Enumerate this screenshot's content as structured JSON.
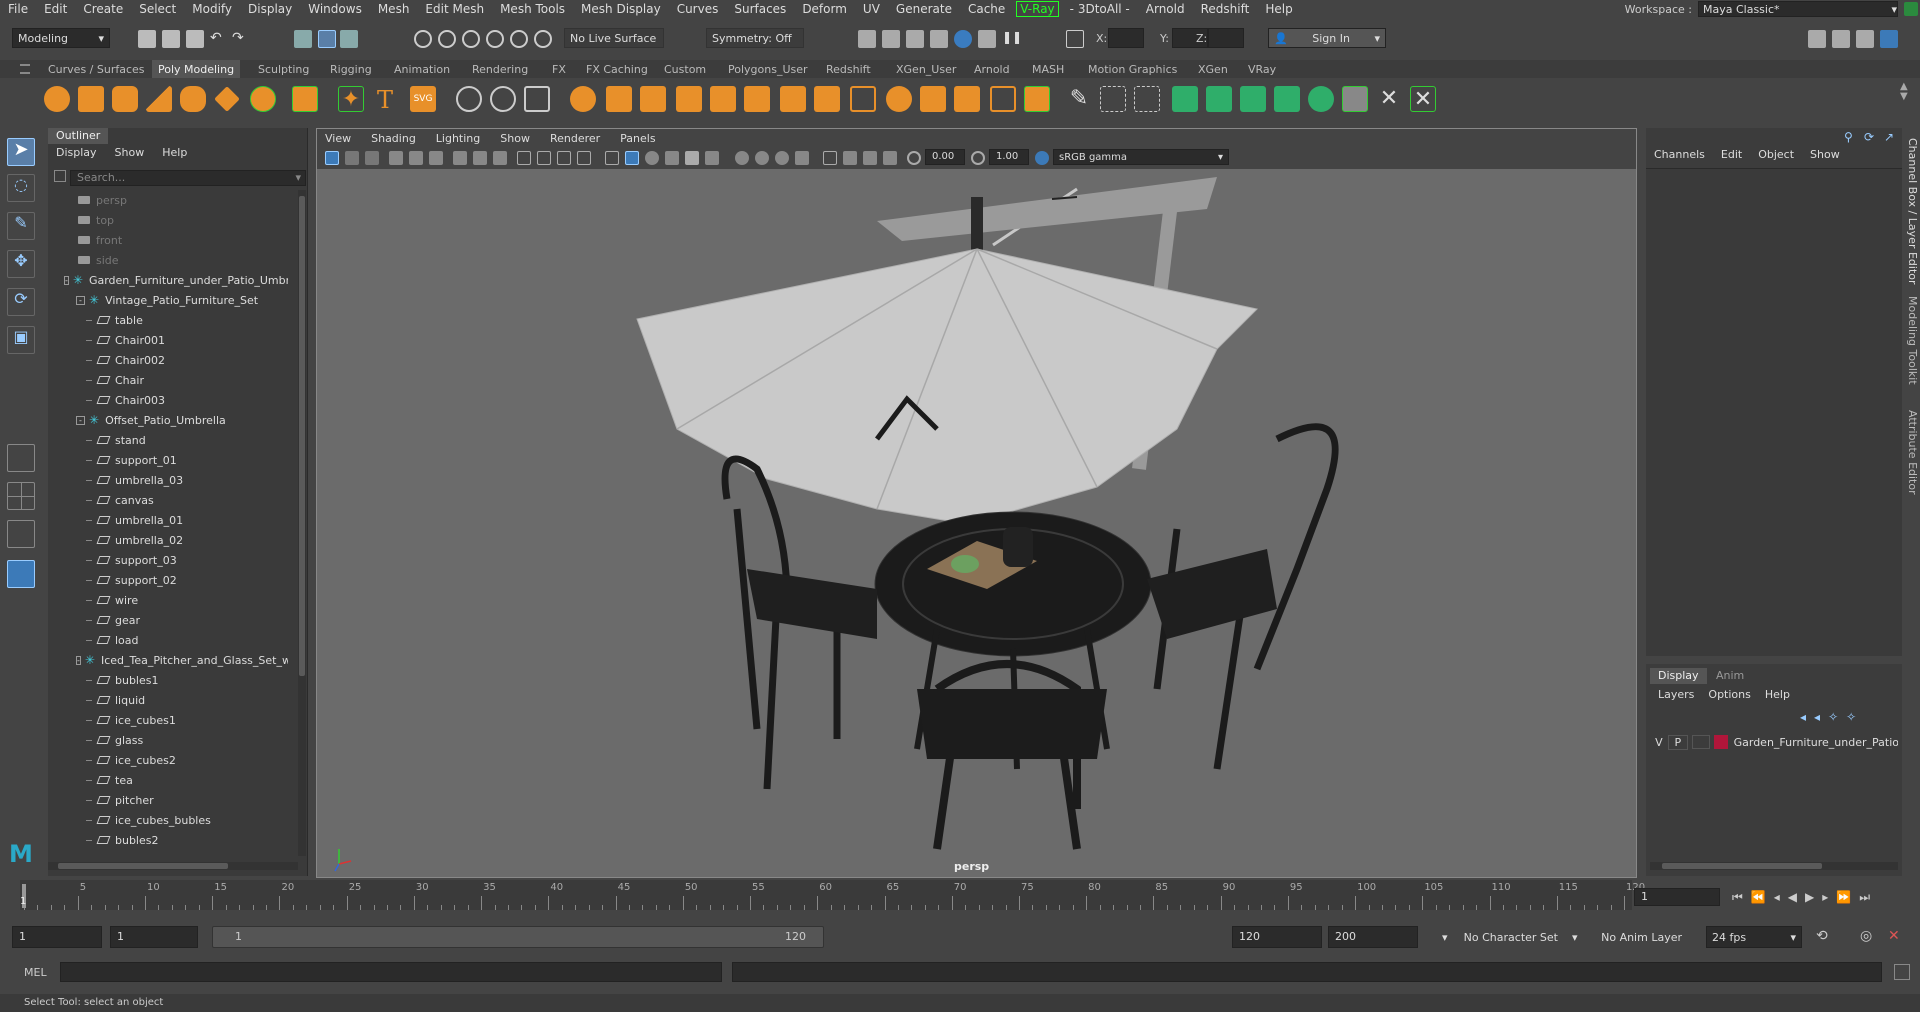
{
  "menubar": {
    "items": [
      "File",
      "Edit",
      "Create",
      "Select",
      "Modify",
      "Display",
      "Windows",
      "Mesh",
      "Edit Mesh",
      "Mesh Tools",
      "Mesh Display",
      "Curves",
      "Surfaces",
      "Deform",
      "UV",
      "Generate",
      "Cache"
    ],
    "vray": "V-Ray",
    "items2": [
      "- 3DtoAll -",
      "Arnold",
      "Redshift",
      "Help"
    ],
    "workspace_label": "Workspace :",
    "workspace_value": "Maya Classic*"
  },
  "statusline": {
    "mode": "Modeling",
    "live_surface": "No Live Surface",
    "symmetry": "Symmetry: Off",
    "x_label": "X:",
    "y_label": "Y:",
    "z_label": "Z:",
    "sign_in": "Sign In"
  },
  "shelf": {
    "tabs": [
      "Curves / Surfaces",
      "Poly Modeling",
      "Sculpting",
      "Rigging",
      "Animation",
      "Rendering",
      "FX",
      "FX Caching",
      "Custom",
      "Polygons_User",
      "Redshift",
      "XGen_User",
      "Arnold",
      "MASH",
      "Motion Graphics",
      "XGen",
      "VRay"
    ],
    "active": "Poly Modeling"
  },
  "outliner": {
    "title": "Outliner",
    "menu": [
      "Display",
      "Show",
      "Help"
    ],
    "search_placeholder": "Search...",
    "items": [
      {
        "label": "persp",
        "type": "camera",
        "indent": 0,
        "dim": true
      },
      {
        "label": "top",
        "type": "camera",
        "indent": 0,
        "dim": true
      },
      {
        "label": "front",
        "type": "camera",
        "indent": 0,
        "dim": true
      },
      {
        "label": "side",
        "type": "camera",
        "indent": 0,
        "dim": true
      },
      {
        "label": "Garden_Furniture_under_Patio_Umbr",
        "type": "group",
        "indent": 0,
        "expand": "-"
      },
      {
        "label": "Vintage_Patio_Furniture_Set",
        "type": "group",
        "indent": 1,
        "expand": "-"
      },
      {
        "label": "table",
        "type": "mesh",
        "indent": 2
      },
      {
        "label": "Chair001",
        "type": "mesh",
        "indent": 2
      },
      {
        "label": "Chair002",
        "type": "mesh",
        "indent": 2
      },
      {
        "label": "Chair",
        "type": "mesh",
        "indent": 2
      },
      {
        "label": "Chair003",
        "type": "mesh",
        "indent": 2
      },
      {
        "label": "Offset_Patio_Umbrella",
        "type": "group",
        "indent": 1,
        "expand": "-"
      },
      {
        "label": "stand",
        "type": "mesh",
        "indent": 2
      },
      {
        "label": "support_01",
        "type": "mesh",
        "indent": 2
      },
      {
        "label": "umbrella_03",
        "type": "mesh",
        "indent": 2
      },
      {
        "label": "canvas",
        "type": "mesh",
        "indent": 2
      },
      {
        "label": "umbrella_01",
        "type": "mesh",
        "indent": 2
      },
      {
        "label": "umbrella_02",
        "type": "mesh",
        "indent": 2
      },
      {
        "label": "support_03",
        "type": "mesh",
        "indent": 2
      },
      {
        "label": "support_02",
        "type": "mesh",
        "indent": 2
      },
      {
        "label": "wire",
        "type": "mesh",
        "indent": 2
      },
      {
        "label": "gear",
        "type": "mesh",
        "indent": 2
      },
      {
        "label": "load",
        "type": "mesh",
        "indent": 2
      },
      {
        "label": "Iced_Tea_Pitcher_and_Glass_Set_wi",
        "type": "group",
        "indent": 1,
        "expand": "-"
      },
      {
        "label": "bubles1",
        "type": "mesh",
        "indent": 2
      },
      {
        "label": "liquid",
        "type": "mesh",
        "indent": 2
      },
      {
        "label": "ice_cubes1",
        "type": "mesh",
        "indent": 2
      },
      {
        "label": "glass",
        "type": "mesh",
        "indent": 2
      },
      {
        "label": "ice_cubes2",
        "type": "mesh",
        "indent": 2
      },
      {
        "label": "tea",
        "type": "mesh",
        "indent": 2
      },
      {
        "label": "pitcher",
        "type": "mesh",
        "indent": 2
      },
      {
        "label": "ice_cubes_bubles",
        "type": "mesh",
        "indent": 2
      },
      {
        "label": "bubles2",
        "type": "mesh",
        "indent": 2
      }
    ]
  },
  "viewport": {
    "menu": [
      "View",
      "Shading",
      "Lighting",
      "Show",
      "Renderer",
      "Panels"
    ],
    "exposure": "0.00",
    "gamma": "1.00",
    "color_space": "sRGB gamma",
    "camera_label": "persp"
  },
  "channelbox": {
    "menu": [
      "Channels",
      "Edit",
      "Object",
      "Show"
    ]
  },
  "layereditor": {
    "tabs": [
      "Display",
      "Anim"
    ],
    "menu": [
      "Layers",
      "Options",
      "Help"
    ],
    "layer": {
      "v": "V",
      "p": "P",
      "name": "Garden_Furniture_under_Patio",
      "color": "#b0163a"
    }
  },
  "sidetabs": [
    "Channel Box / Layer Editor",
    "Modeling Toolkit",
    "Attribute Editor"
  ],
  "timeline": {
    "labels": [
      "5",
      "10",
      "15",
      "20",
      "25",
      "30",
      "35",
      "40",
      "45",
      "50",
      "55",
      "60",
      "65",
      "70",
      "75",
      "80",
      "85",
      "90",
      "95",
      "100",
      "105",
      "110",
      "115",
      "120"
    ],
    "current_frame": "1",
    "current_frame_marker": "1"
  },
  "range": {
    "start": "1",
    "playback_start": "1",
    "slider_start": "1",
    "slider_end": "120",
    "playback_end": "120",
    "end": "200",
    "character_set": "No Character Set",
    "anim_layer": "No Anim Layer",
    "fps": "24 fps"
  },
  "cmdline": {
    "label": "MEL"
  },
  "helpline": {
    "text": "Select Tool: select an object"
  },
  "colors": {
    "accent": "#5aa0d8",
    "vray_green": "#22ff22",
    "shelf_orange": "#e8902a",
    "teal": "#44ccdd"
  }
}
